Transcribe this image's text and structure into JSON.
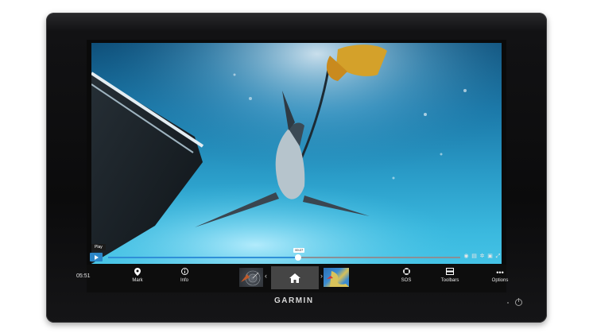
{
  "device": {
    "brand": "GARMIN"
  },
  "video": {
    "play_tooltip": "Play",
    "position_label": "00:27",
    "progress": 0.54,
    "tools": [
      "record-icon",
      "playlist-icon",
      "settings-icon",
      "window-icon",
      "fullscreen-icon"
    ]
  },
  "bottom_bar": {
    "clock": "05:51",
    "mark_label": "Mark",
    "info_label": "Info",
    "sos_label": "SOS",
    "toolbars_label": "Toolbars",
    "options_label": "Options"
  }
}
